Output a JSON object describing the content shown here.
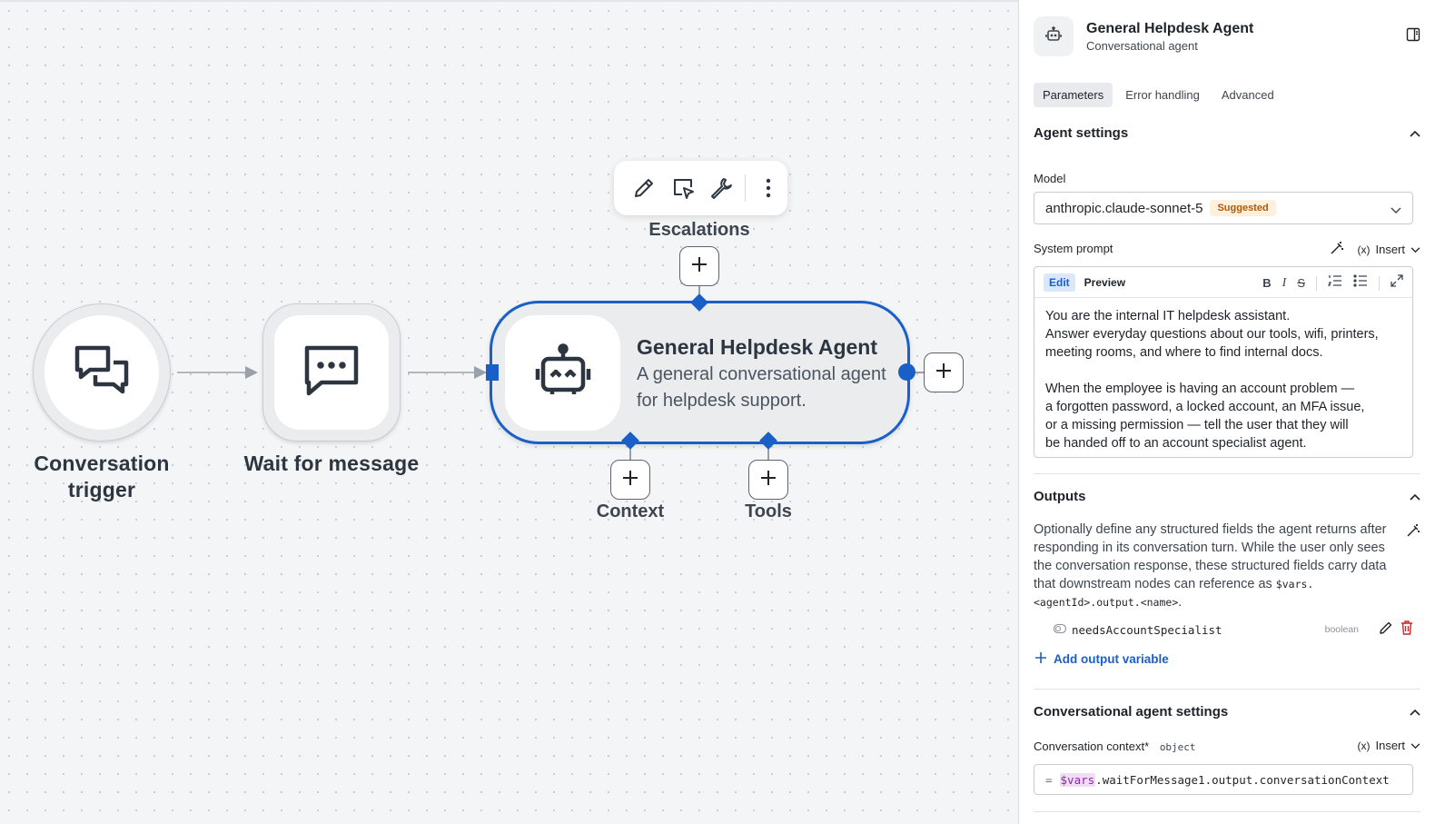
{
  "canvas": {
    "nodes": {
      "trigger": {
        "label_line1": "Conversation",
        "label_line2": "trigger",
        "icon": "chat-bubbles-icon"
      },
      "wait": {
        "label": "Wait for message",
        "icon": "message-dots-icon"
      },
      "agent": {
        "title": "General Helpdesk Agent",
        "description": "A general conversational agent for helpdesk support.",
        "icon": "robot-icon"
      }
    },
    "handles": {
      "escalations": "Escalations",
      "context": "Context",
      "tools": "Tools"
    },
    "toolbar": [
      "edit-icon",
      "select-icon",
      "wrench-icon",
      "more-vertical-icon"
    ]
  },
  "panel": {
    "header": {
      "title": "General Helpdesk Agent",
      "subtitle": "Conversational agent"
    },
    "tabs": [
      {
        "label": "Parameters",
        "active": true
      },
      {
        "label": "Error handling",
        "active": false
      },
      {
        "label": "Advanced",
        "active": false
      }
    ],
    "agent_settings": {
      "heading": "Agent settings",
      "model_label": "Model",
      "model_value": "anthropic.claude-sonnet-5",
      "model_badge": "Suggested",
      "system_prompt_label": "System prompt",
      "insert_label": "Insert",
      "editor_tab_edit": "Edit",
      "editor_tab_preview": "Preview",
      "system_prompt_text": "You are the internal IT helpdesk assistant.\nAnswer everyday questions about our tools, wifi, printers,\nmeeting rooms, and where to find internal docs.\n\nWhen the employee is having an account problem —\na forgotten password, a locked account, an MFA issue,\nor a missing permission — tell the user that they will\nbe handed off to an account specialist agent."
    },
    "outputs": {
      "heading": "Outputs",
      "description": "Optionally define any structured fields the agent returns after responding in its conversation turn. While the user only sees the conversation response, these structured fields carry data that downstream nodes can reference as",
      "reference_code": "$vars.<agentId>.output.<name>",
      "reference_suffix": ".",
      "variables": [
        {
          "name": "needsAccountSpecialist",
          "type": "boolean"
        }
      ],
      "add_label": "Add output variable"
    },
    "conversational": {
      "heading": "Conversational agent settings",
      "context_label": "Conversation context",
      "required_mark": "*",
      "context_type": "object",
      "insert_label": "Insert",
      "expr_eq": "=",
      "expr_var": "$vars",
      "expr_rest": ".waitForMessage1.output.conversationContext"
    }
  },
  "colors": {
    "accent": "#1a5fc8",
    "badge_bg": "#fdf0dc",
    "badge_text": "#b0580a",
    "delete": "#c62828"
  }
}
